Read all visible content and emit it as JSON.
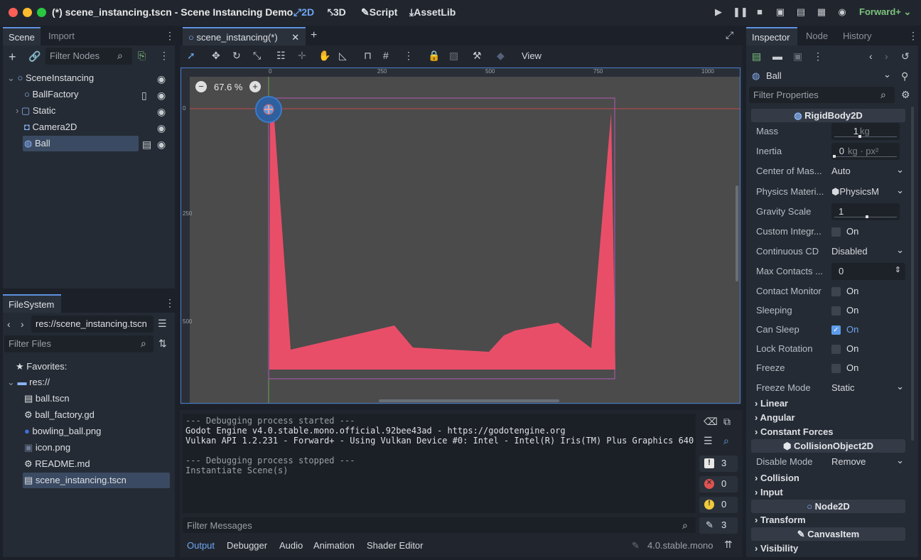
{
  "window": {
    "title": "(*) scene_instancing.tscn - Scene Instancing Demo"
  },
  "workspaces": [
    {
      "label": "2D",
      "icon": "2d-icon"
    },
    {
      "label": "3D",
      "icon": "3d-icon"
    },
    {
      "label": "Script",
      "icon": "script-icon"
    },
    {
      "label": "AssetLib",
      "icon": "assetlib-icon"
    }
  ],
  "renderer": "Forward+",
  "scene_dock": {
    "tabs": [
      "Scene",
      "Import"
    ],
    "filter_placeholder": "Filter Nodes",
    "nodes": [
      {
        "label": "SceneInstancing",
        "icon": "node-circle-icon"
      },
      {
        "label": "BallFactory",
        "icon": "node-circle-icon"
      },
      {
        "label": "Static",
        "icon": "static-body-icon"
      },
      {
        "label": "Camera2D",
        "icon": "camera-icon"
      },
      {
        "label": "Ball",
        "icon": "rigid-body-icon"
      }
    ]
  },
  "filesystem": {
    "tab": "FileSystem",
    "path": "res://scene_instancing.tscn",
    "filter_placeholder": "Filter Files",
    "items": [
      {
        "label": "Favorites:",
        "icon": "star-icon"
      },
      {
        "label": "res://",
        "icon": "folder-icon"
      },
      {
        "label": "ball.tscn",
        "icon": "scene-file-icon"
      },
      {
        "label": "ball_factory.gd",
        "icon": "gear-script-icon"
      },
      {
        "label": "bowling_ball.png",
        "icon": "image-icon"
      },
      {
        "label": "icon.png",
        "icon": "image-icon"
      },
      {
        "label": "README.md",
        "icon": "gear-doc-icon"
      },
      {
        "label": "scene_instancing.tscn",
        "icon": "scene-file-icon"
      }
    ]
  },
  "editor": {
    "tab": "scene_instancing(*)",
    "view_menu": "View",
    "zoom": "67.6 %",
    "ruler_x": [
      "0",
      "250",
      "500",
      "750",
      "1000"
    ],
    "ruler_y": [
      "0",
      "250",
      "500"
    ]
  },
  "output": {
    "lines": [
      "--- Debugging process started ---",
      "Godot Engine v4.0.stable.mono.official.92bee43ad - https://godotengine.org",
      "Vulkan API 1.2.231 - Forward+ - Using Vulkan Device #0: Intel - Intel(R) Iris(TM) Plus Graphics 640",
      "",
      "--- Debugging process stopped ---",
      "Instantiate Scene(s)"
    ],
    "counts": {
      "messages": "3",
      "errors": "0",
      "warnings": "0",
      "editor": "3"
    },
    "filter_placeholder": "Filter Messages",
    "bottom_tabs": [
      "Output",
      "Debugger",
      "Audio",
      "Animation",
      "Shader Editor"
    ],
    "version": "4.0.stable.mono"
  },
  "inspector": {
    "tabs": [
      "Inspector",
      "Node",
      "History"
    ],
    "node": "Ball",
    "filter_placeholder": "Filter Properties",
    "class_header": "RigidBody2D",
    "props": {
      "mass": {
        "label": "Mass",
        "value": "1",
        "unit": "kg"
      },
      "inertia": {
        "label": "Inertia",
        "value": "0",
        "unit": "kg · px²"
      },
      "center": {
        "label": "Center of Mas...",
        "value": "Auto"
      },
      "physics_material": {
        "label": "Physics Materi...",
        "value": "PhysicsM"
      },
      "gravity": {
        "label": "Gravity Scale",
        "value": "1"
      },
      "custom_integrator": {
        "label": "Custom Integr...",
        "value": "On",
        "checked": false
      },
      "continuous_cd": {
        "label": "Continuous CD",
        "value": "Disabled"
      },
      "max_contacts": {
        "label": "Max Contacts ...",
        "value": "0"
      },
      "contact_monitor": {
        "label": "Contact Monitor",
        "value": "On",
        "checked": false
      },
      "sleeping": {
        "label": "Sleeping",
        "value": "On",
        "checked": false
      },
      "can_sleep": {
        "label": "Can Sleep",
        "value": "On",
        "checked": true
      },
      "lock_rotation": {
        "label": "Lock Rotation",
        "value": "On",
        "checked": false
      },
      "freeze": {
        "label": "Freeze",
        "value": "On",
        "checked": false
      },
      "freeze_mode": {
        "label": "Freeze Mode",
        "value": "Static"
      }
    },
    "groups": {
      "linear": "Linear",
      "angular": "Angular",
      "constant_forces": "Constant Forces"
    },
    "collision_header": "CollisionObject2D",
    "disable_mode": {
      "label": "Disable Mode",
      "value": "Remove"
    },
    "groups2": {
      "collision": "Collision",
      "input": "Input"
    },
    "node2d_header": "Node2D",
    "transform": "Transform",
    "canvas_header": "CanvasItem",
    "visibility": "Visibility"
  },
  "colors": {
    "accent": "#6da6f2",
    "static_body": "#e94e69",
    "selection": "#3a4a62"
  }
}
